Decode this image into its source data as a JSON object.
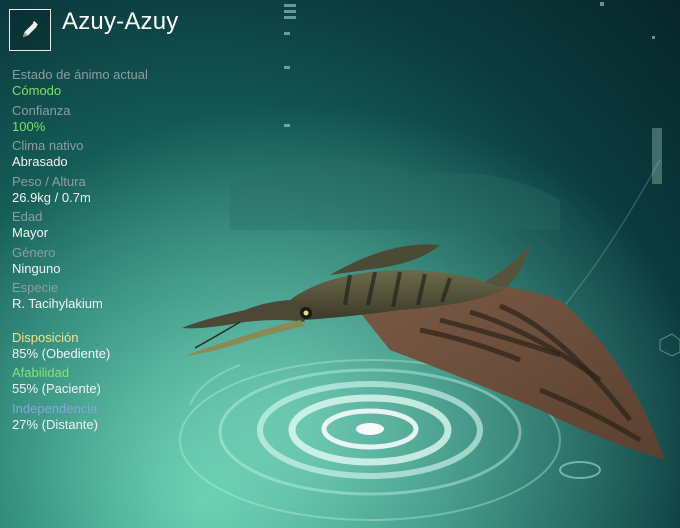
{
  "creature": {
    "name": "Azuy-Azuy"
  },
  "edit_icon": "pencil-icon",
  "stats": [
    {
      "label": "Estado de ánimo actual",
      "value": "Cómodo",
      "highlight": true
    },
    {
      "label": "Confianza",
      "value": "100%",
      "highlight": true
    },
    {
      "label": "Clima nativo",
      "value": "Abrasado",
      "highlight": false
    },
    {
      "label": "Peso / Altura",
      "value": "26.9kg / 0.7m",
      "highlight": false
    },
    {
      "label": "Edad",
      "value": "Mayor",
      "highlight": false
    },
    {
      "label": "Género",
      "value": "Ninguno",
      "highlight": false
    },
    {
      "label": "Especie",
      "value": "R. Tacihylakium",
      "highlight": false
    }
  ],
  "traits": [
    {
      "label": "Disposición",
      "value": "85% (Obediente)",
      "color": "#f2e38a"
    },
    {
      "label": "Afabilidad",
      "value": "55% (Paciente)",
      "color": "#8be079"
    },
    {
      "label": "Independencia",
      "value": "27% (Distante)",
      "color": "#8aa4e0"
    }
  ],
  "colors": {
    "accent_green": "#7de267",
    "label_gray": "#8e9e9e",
    "background_teal": "#155e58"
  }
}
